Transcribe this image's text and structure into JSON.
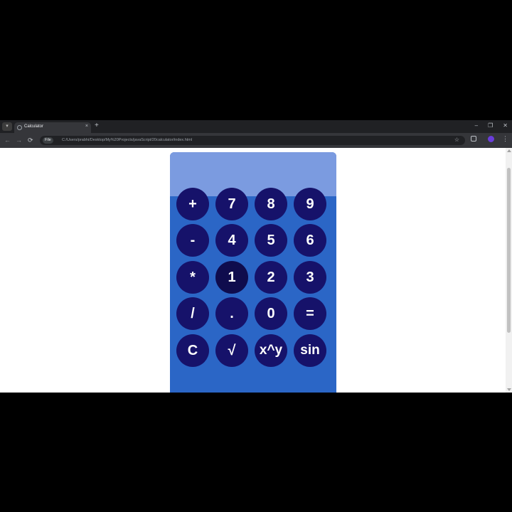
{
  "browser": {
    "tab": {
      "title": "Calculator",
      "menu_glyph": "▾",
      "close_glyph": "×"
    },
    "new_tab_glyph": "+",
    "window_controls": {
      "minimize": "–",
      "restore": "❐",
      "close": "✕"
    },
    "nav": {
      "back": "←",
      "forward": "→",
      "reload": "⟳"
    },
    "address": {
      "site_info_label": "File",
      "url": "C:/Users/prabhi/Desktop/My%20Projects/javaScript/20calculator/index.html"
    },
    "icons": {
      "star": "☆",
      "menu": "⋮"
    },
    "colors": {
      "profile": "#6a3ddb",
      "frame": "#202124",
      "toolbar": "#35363a"
    }
  },
  "calculator": {
    "display_value": "",
    "colors": {
      "body": "#2b66c6",
      "display": "#7b9be0",
      "key": "#16126a",
      "key_text": "#ffffff"
    },
    "keys": [
      [
        "+",
        "7",
        "8",
        "9"
      ],
      [
        "-",
        "4",
        "5",
        "6"
      ],
      [
        "*",
        "1",
        "2",
        "3"
      ],
      [
        "/",
        ".",
        "0",
        "="
      ],
      [
        "C",
        "√",
        "x^y",
        "sin"
      ]
    ]
  }
}
